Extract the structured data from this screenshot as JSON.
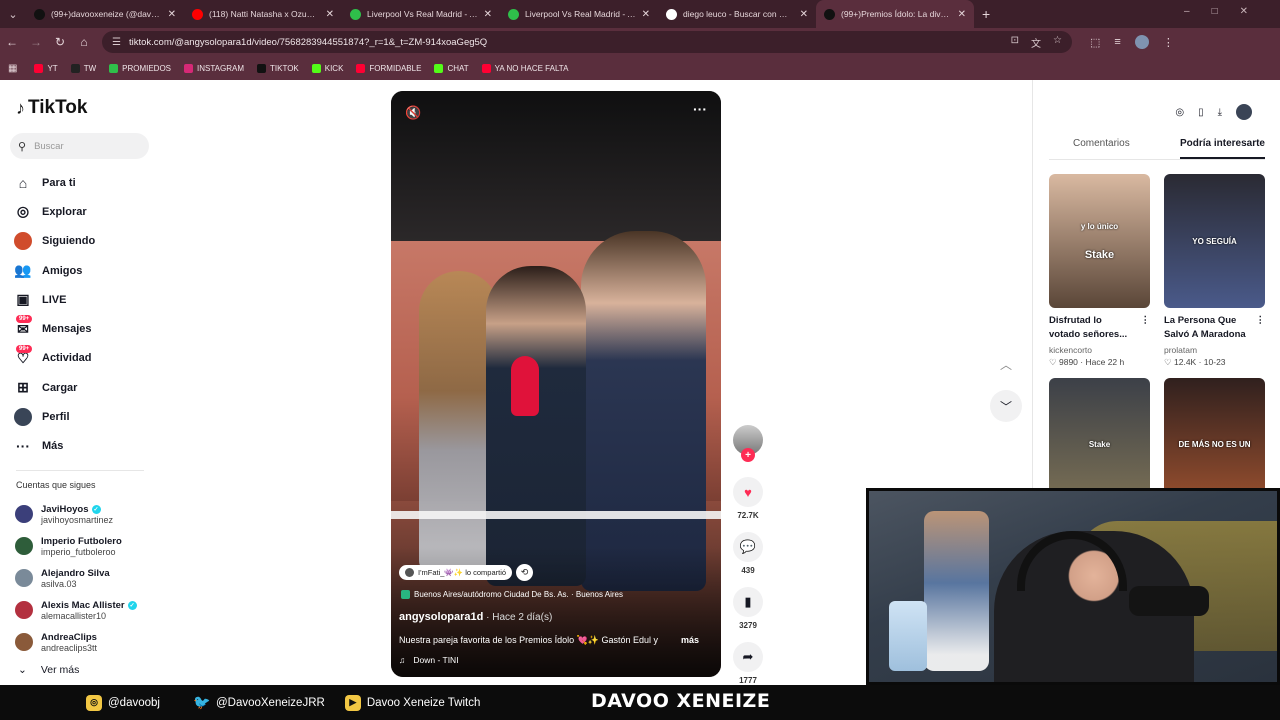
{
  "browser": {
    "tabs": [
      {
        "title": "(99+)davooxeneize (@davooxe",
        "favicon_color": "#111111"
      },
      {
        "title": "(118) Natti Natasha x Ozuna - C",
        "favicon_color": "#ff0000"
      },
      {
        "title": "Liverpool Vs Real Madrid - Alin",
        "favicon_color": "#2fbf4a"
      },
      {
        "title": "Liverpool Vs Real Madrid - Alin",
        "favicon_color": "#2fbf4a"
      },
      {
        "title": "diego leuco - Buscar con Googl",
        "favicon_color": "#ffffff"
      },
      {
        "title": "(99+)Premios Ídolo: La divertid",
        "favicon_color": "#111111"
      }
    ],
    "url": "tiktok.com/@angysolopara1d/video/7568283944551874?_r=1&_t=ZM-914xoaGeg5Q",
    "bookmarks": [
      {
        "label": "YT",
        "color": "#ff0033"
      },
      {
        "label": "TW",
        "color": "#222222"
      },
      {
        "label": "PROMIEDOS",
        "color": "#2fbf4a"
      },
      {
        "label": "INSTAGRAM",
        "color": "#d62976"
      },
      {
        "label": "TIKTOK",
        "color": "#111111"
      },
      {
        "label": "KICK",
        "color": "#53fc18"
      },
      {
        "label": "FORMIDABLE",
        "color": "#ff0033"
      },
      {
        "label": "CHAT",
        "color": "#53fc18"
      },
      {
        "label": "YA NO HACE FALTA",
        "color": "#ff0033"
      }
    ]
  },
  "tiktok": {
    "logo": "TikTok",
    "search_placeholder": "Buscar",
    "nav": [
      {
        "label": "Para ti",
        "icon": "home-icon"
      },
      {
        "label": "Explorar",
        "icon": "compass-icon"
      },
      {
        "label": "Siguiendo",
        "icon": "following-avatar"
      },
      {
        "label": "Amigos",
        "icon": "friends-icon"
      },
      {
        "label": "LIVE",
        "icon": "live-icon"
      },
      {
        "label": "Mensajes",
        "icon": "messages-icon",
        "badge": "99+"
      },
      {
        "label": "Actividad",
        "icon": "activity-icon",
        "badge": "99+"
      },
      {
        "label": "Cargar",
        "icon": "upload-icon"
      },
      {
        "label": "Perfil",
        "icon": "profile-avatar"
      },
      {
        "label": "Más",
        "icon": "more-icon"
      }
    ],
    "following_header": "Cuentas que sigues",
    "following": [
      {
        "name": "JaviHoyos",
        "user": "javihoyosmartinez",
        "verified": true,
        "color": "#3b3f7a"
      },
      {
        "name": "Imperio Futbolero",
        "user": "imperio_futboleroo",
        "verified": false,
        "color": "#2e5d3a"
      },
      {
        "name": "Alejandro Silva",
        "user": "asilva.03",
        "verified": false,
        "color": "#7a8a99"
      },
      {
        "name": "Alexis Mac Allister",
        "user": "alemacallister10",
        "verified": true,
        "color": "#b3303f"
      },
      {
        "name": "AndreaClips",
        "user": "andreaclips3tt",
        "verified": false,
        "color": "#8a5a3a"
      }
    ],
    "see_more": "Ver más"
  },
  "video": {
    "shared_by": "I'mFati_👾✨ lo compartió",
    "location": "Buenos Aires/autódromo Ciudad De Bs. As. · Buenos Aires",
    "author": "angysolopara1d",
    "time": " · Hace 2 día(s)",
    "caption": "Nuestra pareja favorita de los Premios Ídolo 💘✨ Gastón Edul y",
    "more": "más",
    "music": "Down - TINI",
    "likes": "72.7K",
    "comments": "439",
    "saves": "3279",
    "shares": "1777"
  },
  "right_panel": {
    "tabs": [
      "Comentarios",
      "Podría interesarte"
    ],
    "active_tab": 1,
    "cards": [
      {
        "title1": "Disfrutad lo",
        "title2": "votado señores...",
        "user": "kickencorto",
        "likes": "9890",
        "date": "Hace 22 h",
        "overlay": "y lo único",
        "overlay2": "Stake",
        "color1": "#d9b9a1",
        "color2": "#5a4638"
      },
      {
        "title1": "La Persona Que",
        "title2": "Salvó A Maradona",
        "user": "prolatam",
        "likes": "12.4K",
        "date": "10-23",
        "overlay": "YO SEGUÍA",
        "overlay2": "",
        "color1": "#2a2a33",
        "color2": "#4a5a8a"
      },
      {
        "title1": "",
        "title2": "",
        "user": "",
        "likes": "",
        "date": "",
        "overlay": "Stake",
        "overlay2": "",
        "color1": "#3c4048",
        "color2": "#7f7355"
      },
      {
        "title1": "",
        "title2": "",
        "user": "",
        "likes": "",
        "date": "",
        "overlay": "DE MÁS NO ES UN",
        "overlay2": "",
        "color1": "#30201e",
        "color2": "#a05330"
      }
    ]
  },
  "footer": {
    "instagram": "@davoobj",
    "twitter": "@DavooXeneizeJRR",
    "twitch": "Davoo Xeneize Twitch",
    "brand": "DAVOO XENEIZE"
  }
}
